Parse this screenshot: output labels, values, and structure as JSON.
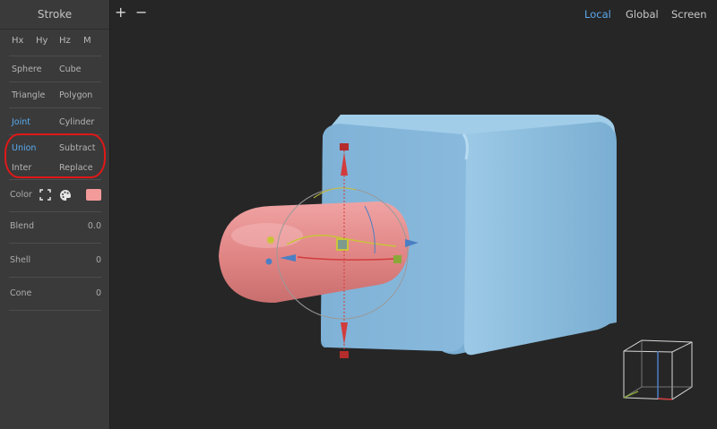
{
  "panel": {
    "title": "Stroke",
    "axes": [
      "Hx",
      "Hy",
      "Hz",
      "M"
    ],
    "primitives": [
      {
        "left": "Sphere",
        "right": "Cube"
      },
      {
        "left": "Triangle",
        "right": "Polygon"
      },
      {
        "left": "Joint",
        "right": "Cylinder"
      }
    ],
    "operations": [
      {
        "left": "Union",
        "right": "Subtract"
      },
      {
        "left": "Inter",
        "right": "Replace"
      }
    ],
    "active_primitive": "Joint",
    "active_operation": "Union",
    "color": {
      "label": "Color",
      "swatch": "#f29b9a",
      "picker_icon": "picker-icon",
      "palette_icon": "palette-icon"
    },
    "blend": {
      "label": "Blend",
      "value": "0.0"
    },
    "shell": {
      "label": "Shell",
      "value": "0"
    },
    "cone": {
      "label": "Cone",
      "value": "0"
    }
  },
  "toolbar": {
    "add_label": "+",
    "remove_label": "−",
    "spaces": [
      "Local",
      "Global",
      "Screen"
    ],
    "active_space": "Local"
  },
  "annotation": {
    "color": "#e01818"
  },
  "colors": {
    "accent": "#59aaf0",
    "cube": "#86b6d8",
    "capsule": "#e58a8a",
    "gizmo_red": "#d23c3c",
    "gizmo_yellow": "#c9c33a",
    "gizmo_blue": "#4a7fc4"
  }
}
